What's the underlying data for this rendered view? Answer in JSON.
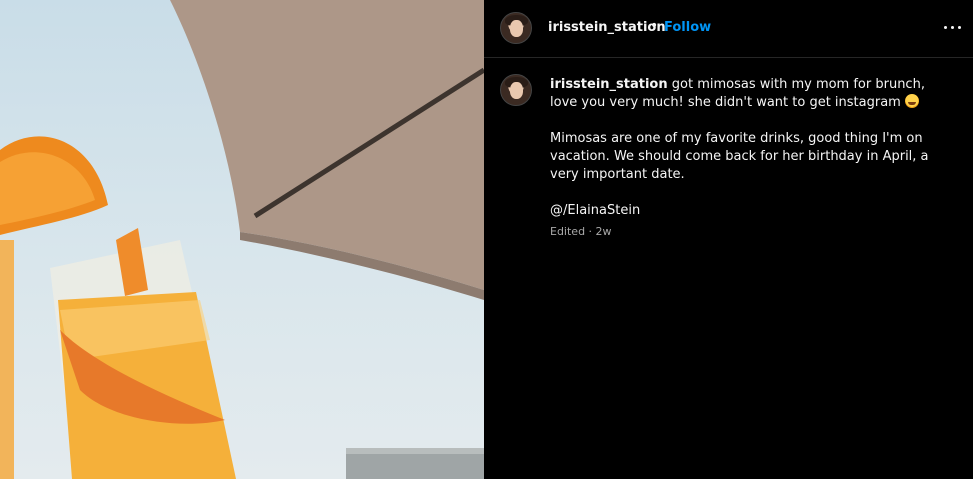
{
  "header": {
    "username": "irisstein_station",
    "separator": "•",
    "follow_label": "Follow",
    "more_icon": "more-options-icon"
  },
  "caption": {
    "username": "irisstein_station",
    "text1": "got mimosas with my mom for brunch, love you very much! she didn't want to get instagram",
    "emoji": "🤣",
    "text2": "Mimosas are one of my favorite drinks, good thing I'm on vacation. We should come back for her birthday in April, a very important date.",
    "mention": "@/ElainaStein"
  },
  "meta": {
    "edited": "Edited · 2w"
  },
  "colors": {
    "background": "#000000",
    "accent": "#0095f6",
    "secondary_text": "#a8a8a8"
  }
}
